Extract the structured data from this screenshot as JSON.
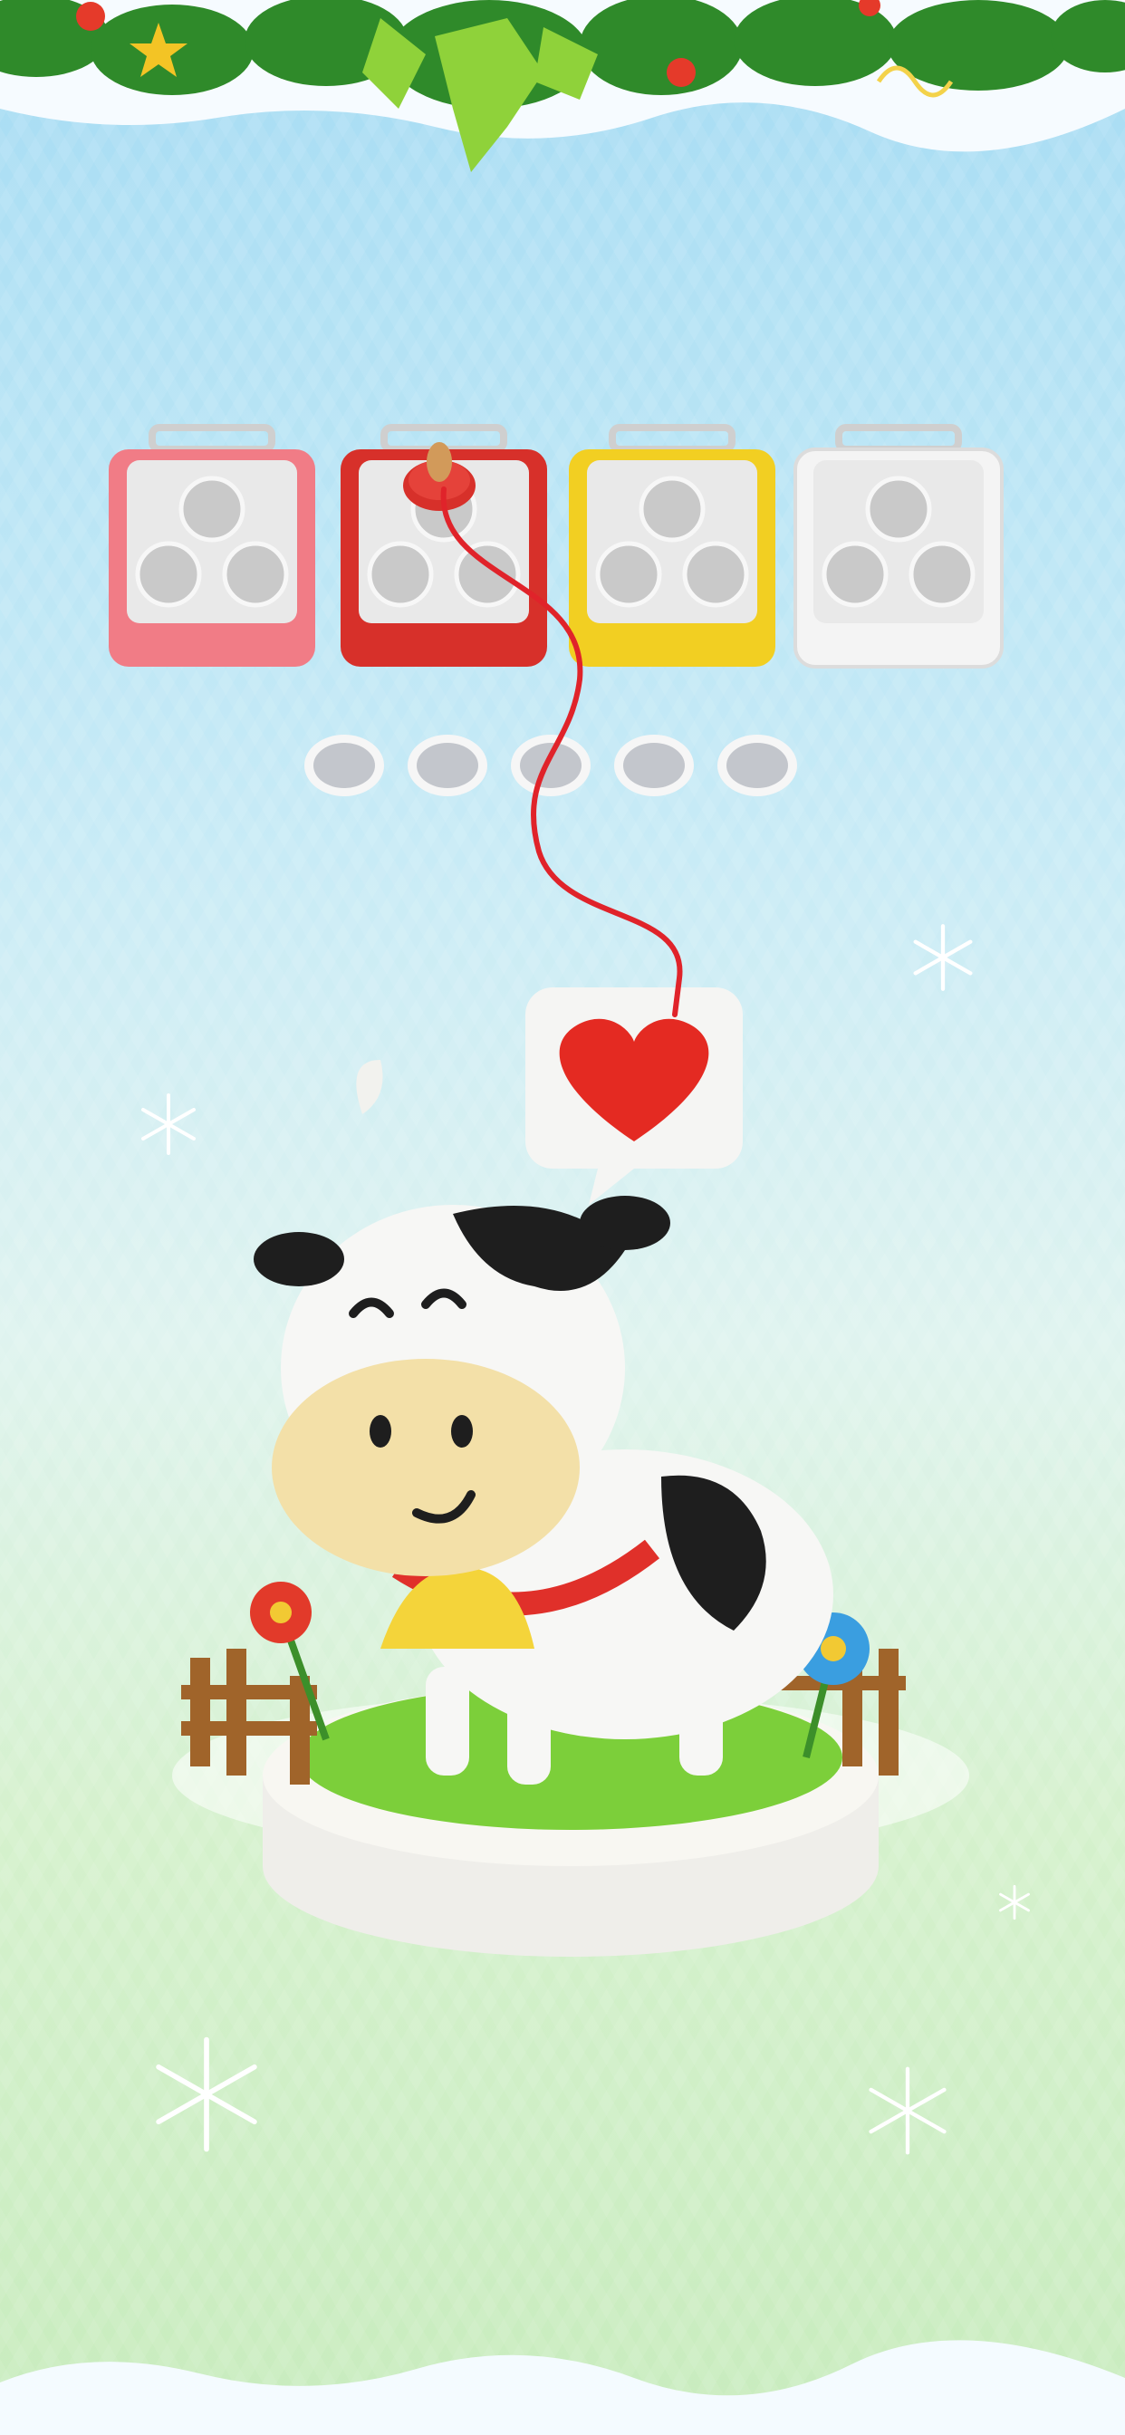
{
  "game": {
    "baskets": [
      {
        "color": "pink",
        "hex": "#f17c86",
        "slots": 3,
        "has_spool": false
      },
      {
        "color": "red",
        "hex": "#d7302a",
        "slots": 3,
        "has_spool": true
      },
      {
        "color": "yellow",
        "hex": "#f2cf22",
        "slots": 3,
        "has_spool": false
      },
      {
        "color": "white",
        "hex": "#ececec",
        "slots": 3,
        "has_spool": false
      }
    ],
    "holding_slots": 5,
    "yarn_thread_color": "#e0232a",
    "figure": {
      "subject": "cow-on-grass-base",
      "heart_color": "#e42a22",
      "bell_color": "#f4d43a",
      "flower_colors": [
        "#e23a2a",
        "#3a9ee0"
      ]
    },
    "theme": {
      "decoration": "christmas-garland",
      "snowflakes": 5
    }
  }
}
